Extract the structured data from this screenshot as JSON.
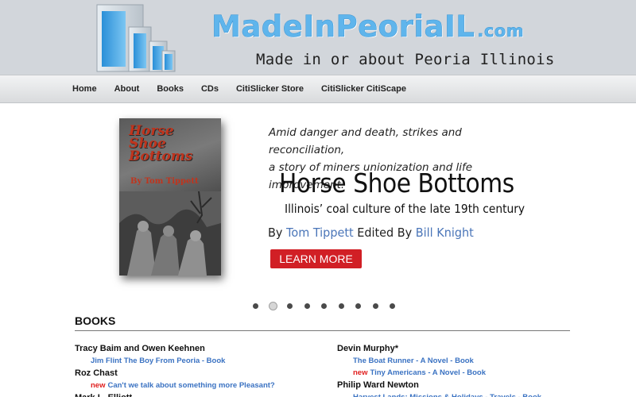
{
  "header": {
    "site_name": "MadeInPeoriaIL",
    "site_suffix": ".com",
    "tagline": "Made in or about Peoria Illinois"
  },
  "nav": {
    "items": [
      "Home",
      "About",
      "Books",
      "CDs",
      "CitiSlicker Store",
      "CitiSlicker CitiScape"
    ]
  },
  "slider": {
    "cover": {
      "title": "Horse Shoe Bottoms",
      "author": "By Tom Tippett"
    },
    "tagline_line1": "Amid danger and death, strikes and reconciliation,",
    "tagline_line2": "a story of miners unionization and life improvement.",
    "title": "Horse Shoe Bottoms",
    "subtitle": "Illinois’ coal culture of the late 19th century",
    "by_label": "By",
    "author": "Tom Tippett",
    "edited_label": "Edited By",
    "editor": "Bill Knight",
    "button_label": "LEARN MORE",
    "slide_count": 9,
    "active_slide": 2
  },
  "books": {
    "heading": "BOOKS",
    "left": [
      {
        "author": "Tracy Baim and Owen Keehnen",
        "titles": [
          {
            "new": false,
            "text": "Jim Flint The Boy From Peoria - Book"
          }
        ]
      },
      {
        "author": "Roz Chast",
        "titles": [
          {
            "new": true,
            "text": "Can't we talk about something more Pleasant?"
          }
        ]
      },
      {
        "author": "Mark L. Elliott",
        "titles": []
      }
    ],
    "right": [
      {
        "author": "Devin Murphy*",
        "titles": [
          {
            "new": false,
            "text": "The Boat Runner - A Novel - Book"
          },
          {
            "new": true,
            "text": "Tiny Americans - A Novel - Book"
          }
        ]
      },
      {
        "author": "Philip Ward Newton",
        "titles": [
          {
            "new": false,
            "text": "Harvest Lands: Missions & Holidays - Travels - Book"
          }
        ]
      }
    ],
    "new_label": "new"
  },
  "colors": {
    "header_bg": "#d2d6db",
    "logo_blue": "#5fb5ec",
    "link_blue": "#3a72c2",
    "new_red": "#e01f1f",
    "button_red": "#d11f25"
  }
}
